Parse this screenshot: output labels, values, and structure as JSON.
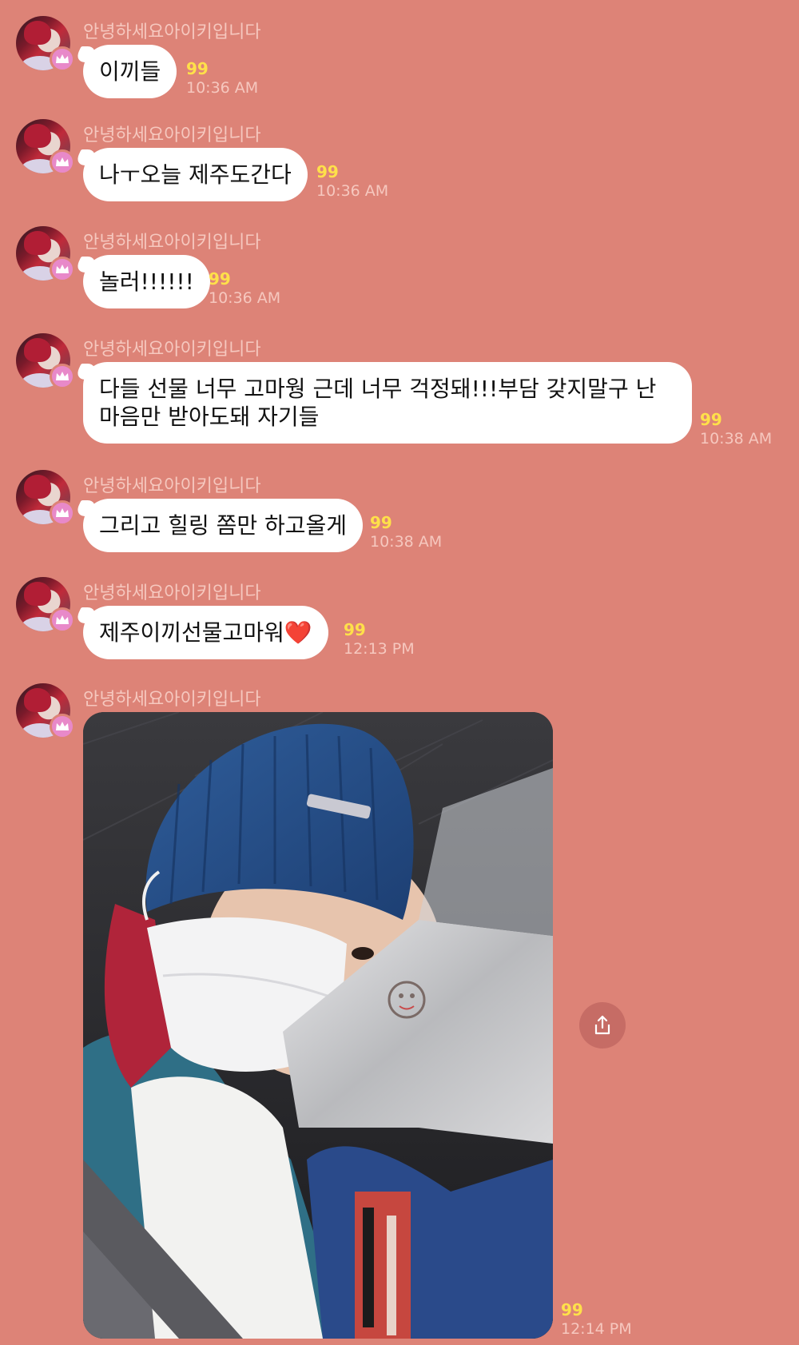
{
  "sender_name": "안녕하세요아이키입니다",
  "colors": {
    "background": "#dd8377",
    "bubble": "#ffffff",
    "count": "#ffe04a",
    "meta": "#f6c8bf",
    "badge": "#e889c9"
  },
  "messages": [
    {
      "text": "이끼들",
      "count": "99",
      "time": "10:36 AM"
    },
    {
      "text": "나ㅜ오늘 제주도간다",
      "count": "99",
      "time": "10:36 AM"
    },
    {
      "text": "놀러!!!!!!",
      "count": "99",
      "time": "10:36 AM"
    },
    {
      "text": "다들 선물 너무 고마웡 근데 너무 걱정돼!!!부담 갖지말구 난 마음만 받아도돼 자기들",
      "count": "99",
      "time": "10:38 AM"
    },
    {
      "text": "그리고 힐링 쫌만 하고올게",
      "count": "99",
      "time": "10:38 AM"
    },
    {
      "text": "제주이끼선물고마워❤️",
      "count": "99",
      "time": "12:13 PM"
    }
  ],
  "photo_message": {
    "count": "99",
    "time": "12:14 PM"
  },
  "icons": {
    "avatar_badge": "crown-icon",
    "share": "share-icon"
  }
}
